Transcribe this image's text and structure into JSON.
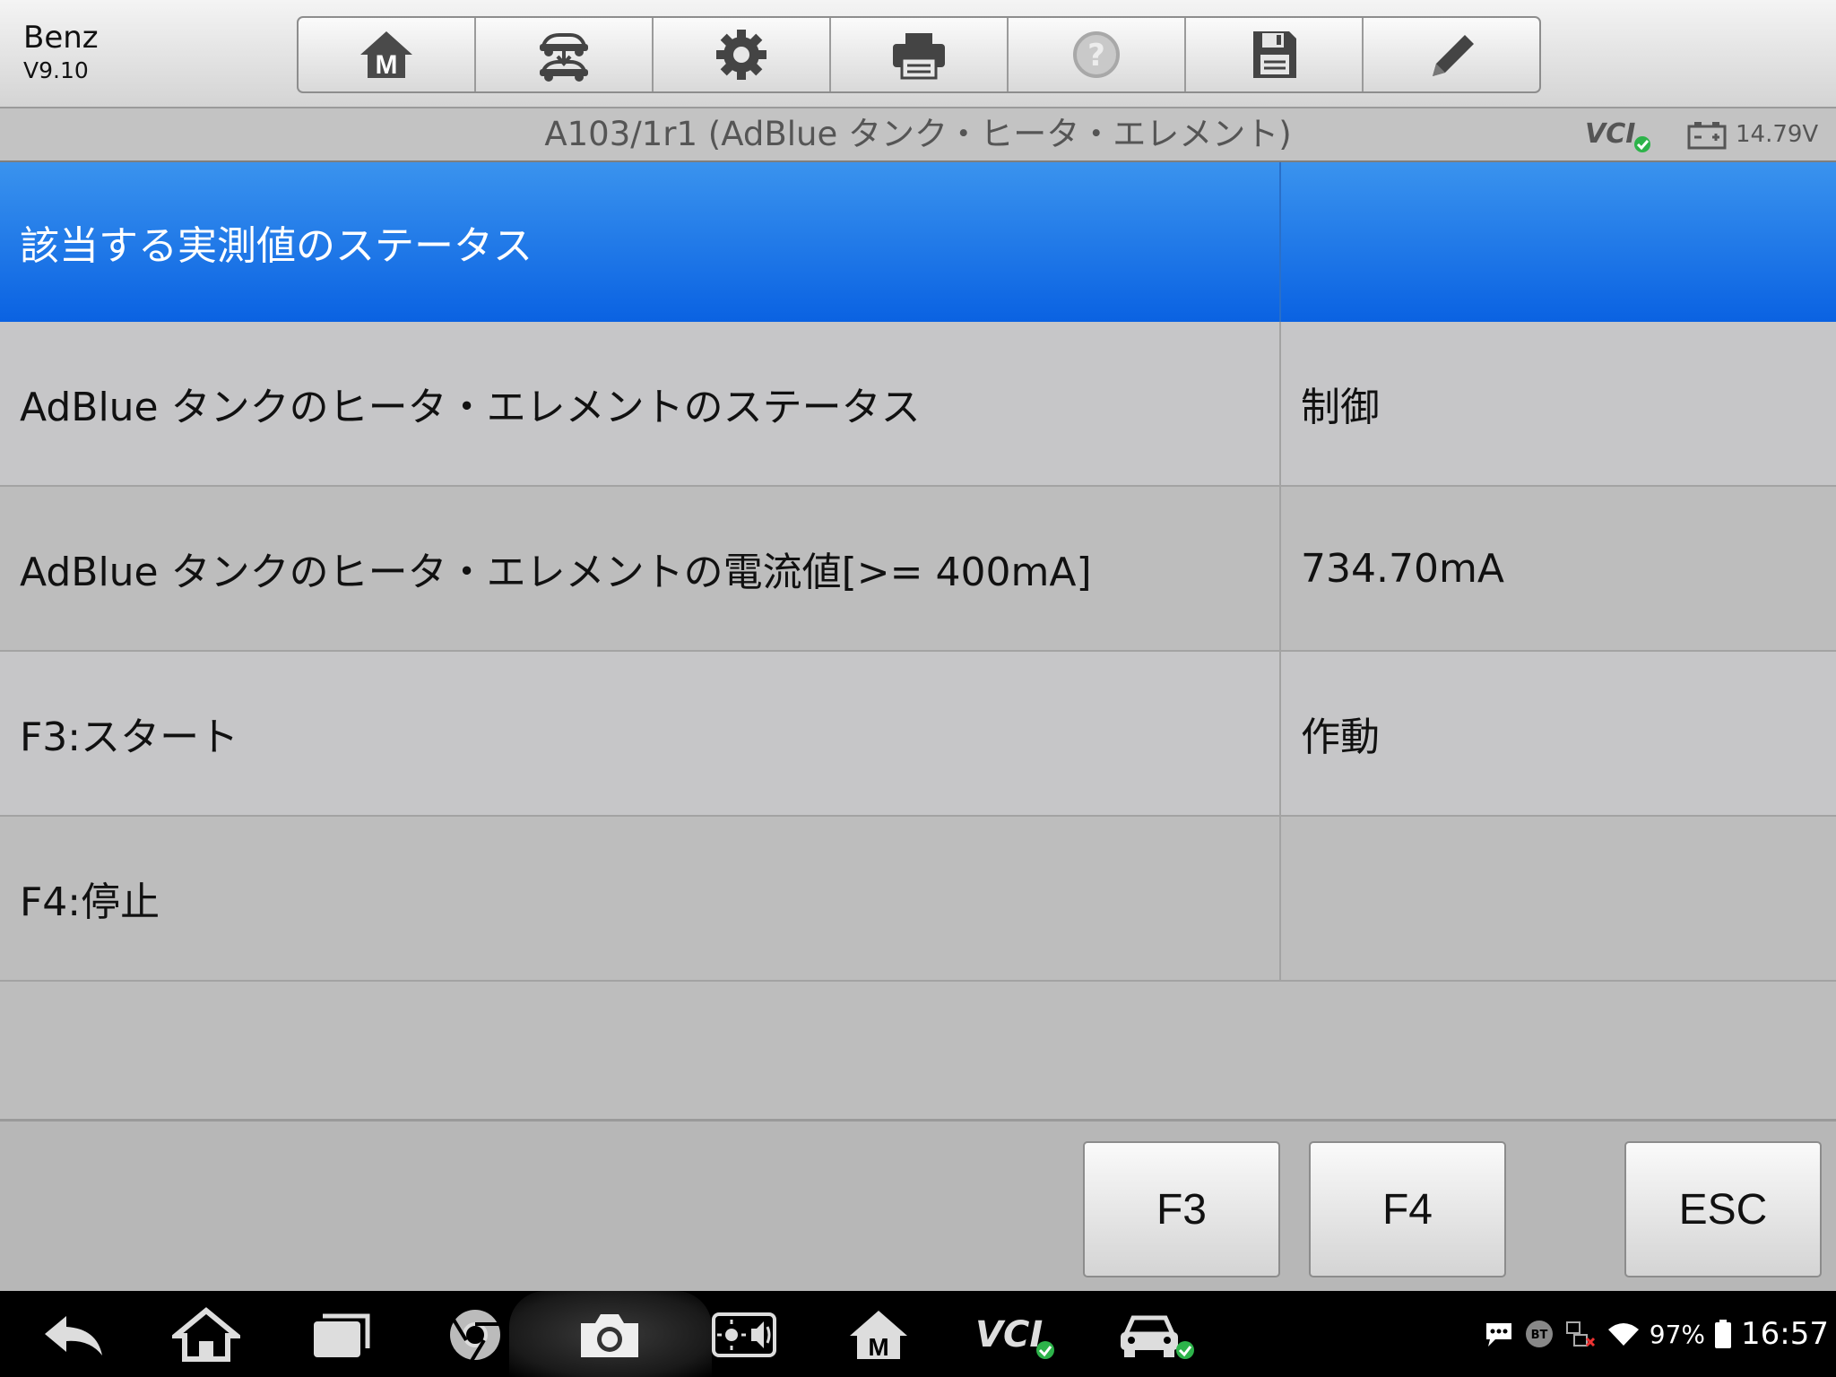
{
  "header": {
    "make": "Benz",
    "version": "V9.10"
  },
  "toolbar": {
    "items": [
      "home-m-icon",
      "car-transfer-icon",
      "gear-icon",
      "printer-icon",
      "help-icon",
      "save-icon",
      "pencil-icon"
    ]
  },
  "titlebar": {
    "title": "A103/1r1 (AdBlue タンク・ヒータ・エレメント)",
    "vcl_label": "VCI",
    "voltage": "14.79V"
  },
  "table": {
    "header": {
      "label": "該当する実測値のステータス",
      "value": ""
    },
    "rows": [
      {
        "label": "AdBlue タンクのヒータ・エレメントのステータス",
        "value": "制御"
      },
      {
        "label": "AdBlue タンクのヒータ・エレメントの電流値[>= 400mA]",
        "value": "734.70mA"
      },
      {
        "label": "F3:スタート",
        "value": "作動"
      },
      {
        "label": "F4:停止",
        "value": ""
      }
    ]
  },
  "footer": {
    "f3_label": "F3",
    "f4_label": "F4",
    "esc_label": "ESC"
  },
  "statusbar": {
    "battery_pct": "97%",
    "time": "16:57",
    "bt_label": "BT"
  },
  "colors": {
    "header_blue": "#1a74e8",
    "vcl_check": "#2db34a"
  }
}
